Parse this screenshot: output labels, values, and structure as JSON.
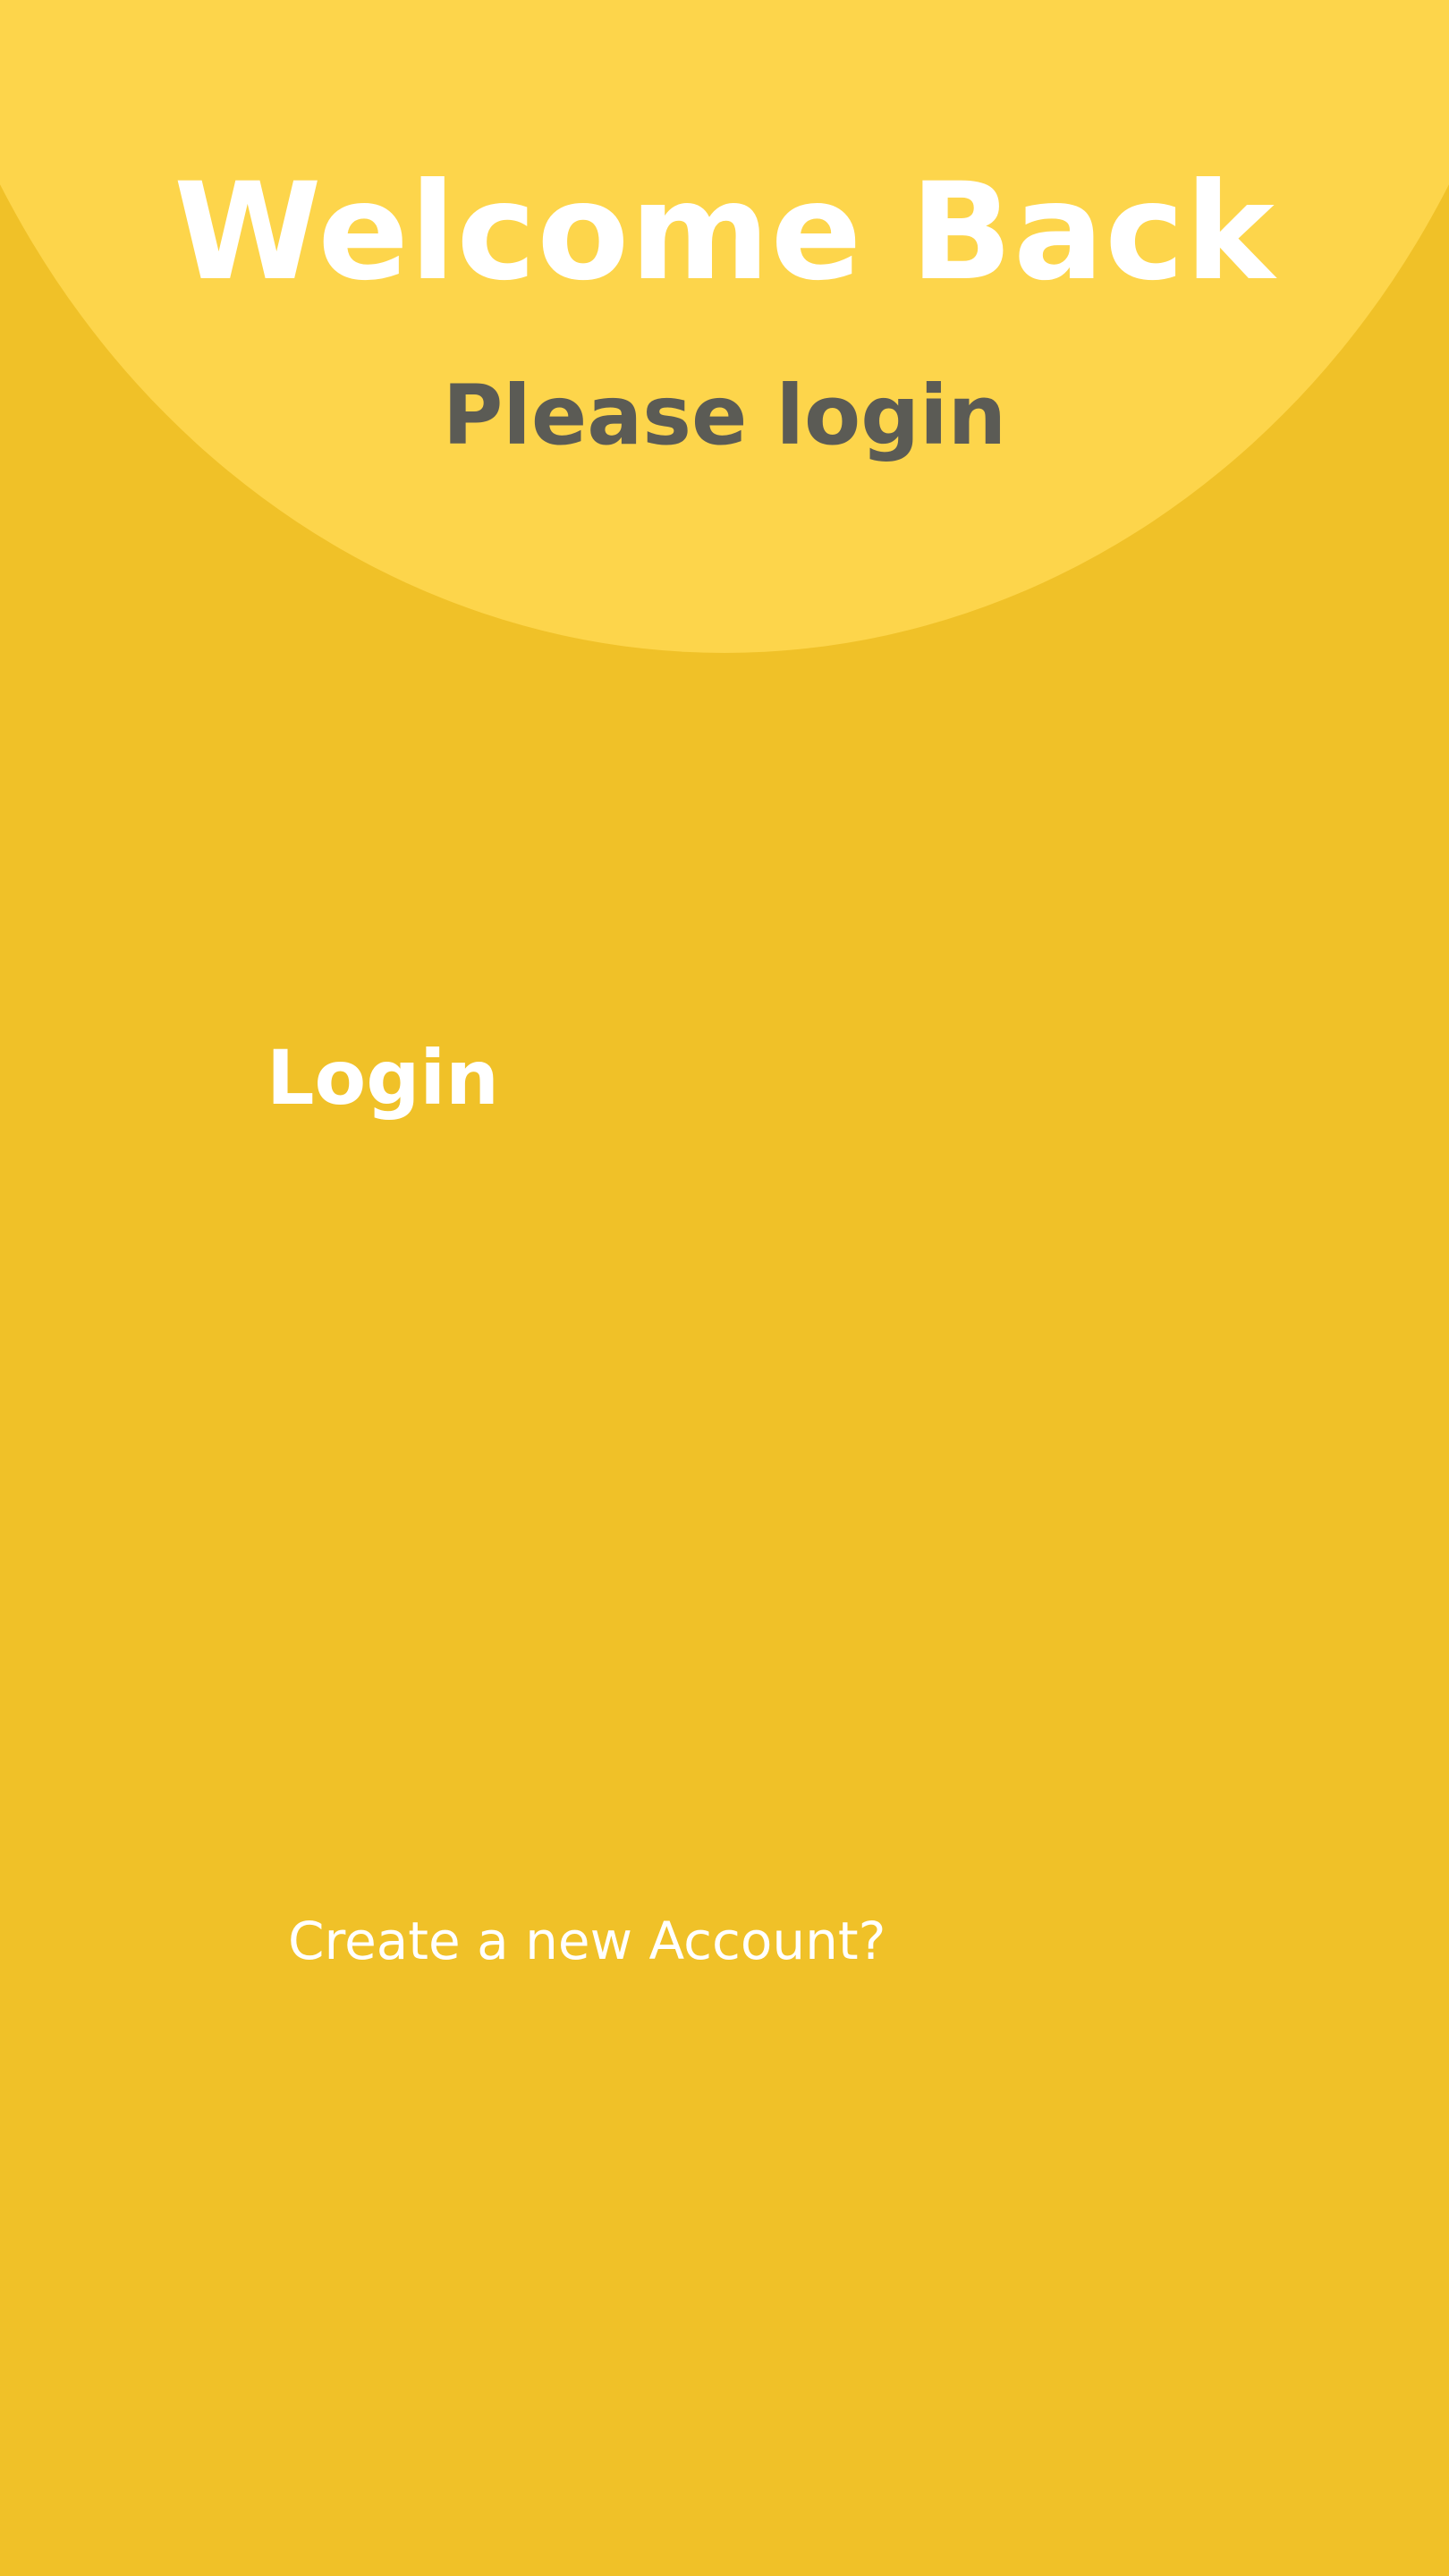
{
  "header": {
    "title": "Welcome Back",
    "subtitle": "Please login"
  },
  "form": {
    "heading": "Login"
  },
  "footer": {
    "create_account_label": "Create a new Account?"
  },
  "colors": {
    "background": "#F0C128",
    "header_arc": "#FDD54B",
    "title_text": "#FFFFFF",
    "subtitle_text": "#5B5B55"
  }
}
